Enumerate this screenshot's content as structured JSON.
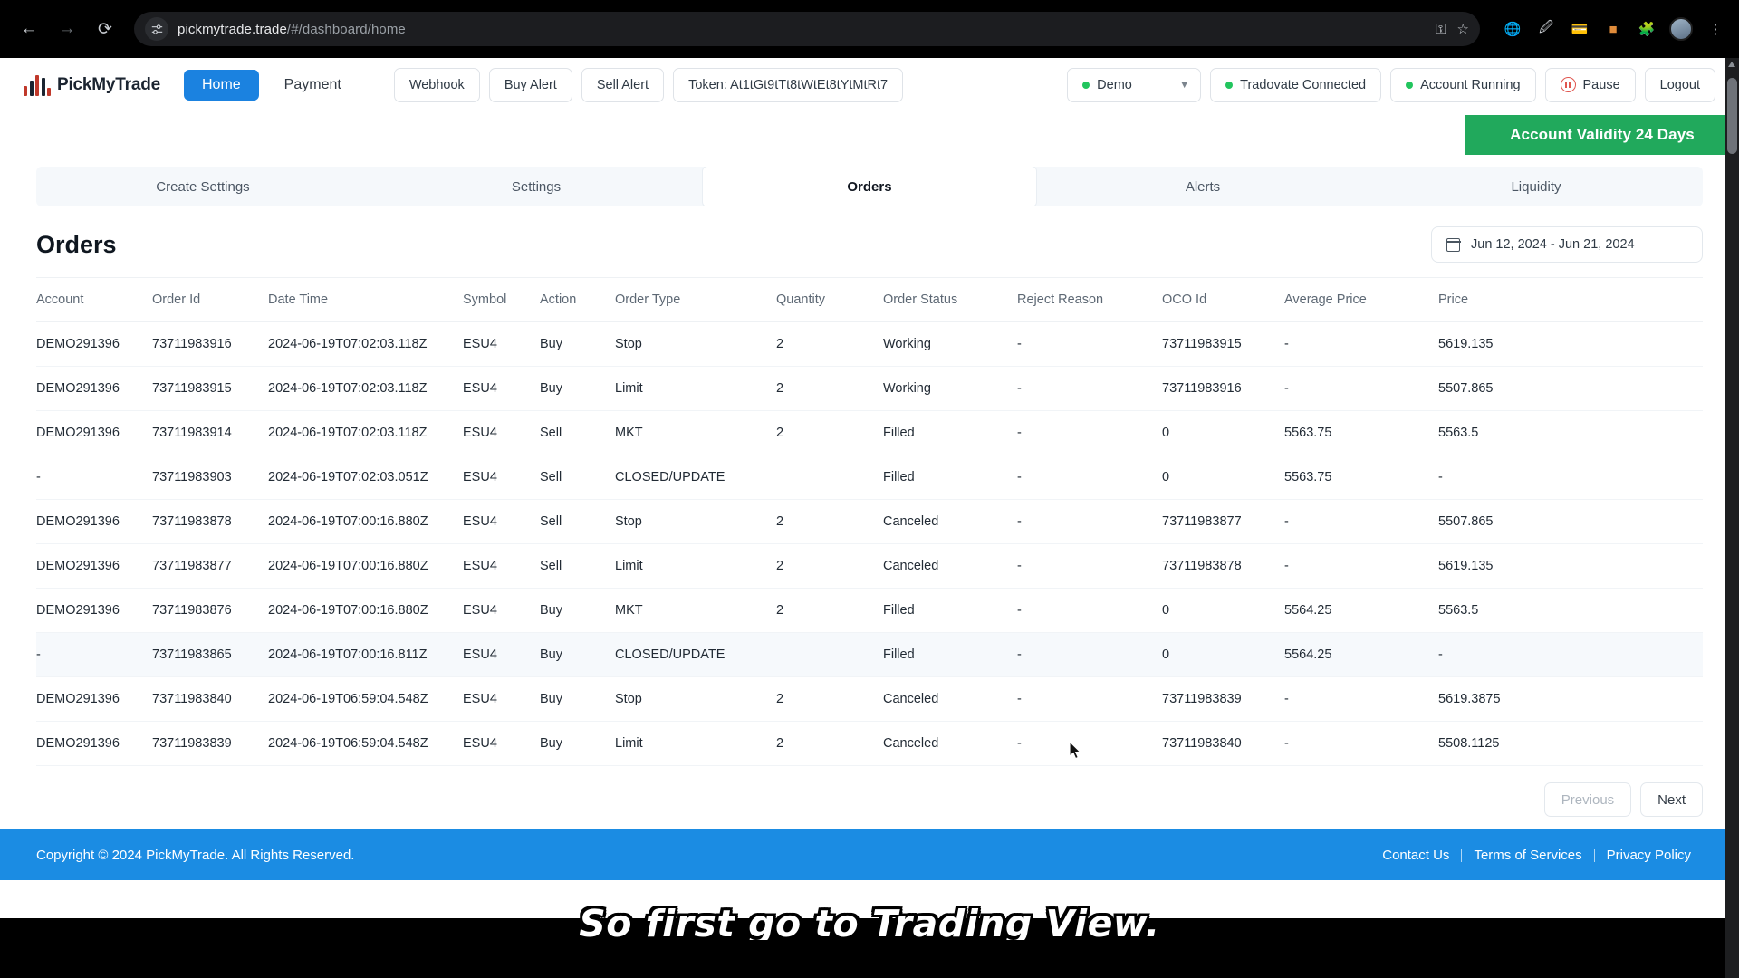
{
  "browser": {
    "url_host": "pickmytrade.trade",
    "url_path": "/#/dashboard/home",
    "back_icon": "back-arrow-icon",
    "forward_icon": "forward-arrow-icon",
    "reload_icon": "reload-icon",
    "site_settings_icon": "site-settings-icon",
    "bookmark_icon": "star-icon",
    "menu_icon": "kebab-menu-icon"
  },
  "header": {
    "brand": "PickMyTrade",
    "nav": {
      "home": "Home",
      "payment": "Payment"
    },
    "buttons": {
      "webhook": "Webhook",
      "buy_alert": "Buy Alert",
      "sell_alert": "Sell Alert",
      "token": "Token: At1tGt9tTt8tWtEt8tYtMtRt7",
      "tradovate": "Tradovate Connected",
      "account_running": "Account Running",
      "pause": "Pause",
      "logout": "Logout"
    },
    "environment_select": {
      "value": "Demo"
    },
    "validity_banner": "Account Validity 24 Days",
    "colors": {
      "accent_blue": "#1b82e0",
      "status_green": "#22c55e",
      "banner_green": "#21a95c",
      "pause_red": "#e0564f",
      "footer_blue": "#1b8ce3"
    }
  },
  "tabs": [
    {
      "label": "Create Settings",
      "active": false
    },
    {
      "label": "Settings",
      "active": false
    },
    {
      "label": "Orders",
      "active": true
    },
    {
      "label": "Alerts",
      "active": false
    },
    {
      "label": "Liquidity",
      "active": false
    }
  ],
  "orders_page": {
    "title": "Orders",
    "date_range": "Jun 12, 2024 - Jun 21, 2024",
    "columns": [
      "Account",
      "Order Id",
      "Date Time",
      "Symbol",
      "Action",
      "Order Type",
      "Quantity",
      "Order Status",
      "Reject Reason",
      "OCO Id",
      "Average Price",
      "Price"
    ],
    "rows": [
      [
        "DEMO291396",
        "73711983916",
        "2024-06-19T07:02:03.118Z",
        "ESU4",
        "Buy",
        "Stop",
        "2",
        "Working",
        "-",
        "73711983915",
        "-",
        "5619.135"
      ],
      [
        "DEMO291396",
        "73711983915",
        "2024-06-19T07:02:03.118Z",
        "ESU4",
        "Buy",
        "Limit",
        "2",
        "Working",
        "-",
        "73711983916",
        "-",
        "5507.865"
      ],
      [
        "DEMO291396",
        "73711983914",
        "2024-06-19T07:02:03.118Z",
        "ESU4",
        "Sell",
        "MKT",
        "2",
        "Filled",
        "-",
        "0",
        "5563.75",
        "5563.5"
      ],
      [
        "-",
        "73711983903",
        "2024-06-19T07:02:03.051Z",
        "ESU4",
        "Sell",
        "CLOSED/UPDATE",
        "",
        "Filled",
        "-",
        "0",
        "5563.75",
        "-"
      ],
      [
        "DEMO291396",
        "73711983878",
        "2024-06-19T07:00:16.880Z",
        "ESU4",
        "Sell",
        "Stop",
        "2",
        "Canceled",
        "-",
        "73711983877",
        "-",
        "5507.865"
      ],
      [
        "DEMO291396",
        "73711983877",
        "2024-06-19T07:00:16.880Z",
        "ESU4",
        "Sell",
        "Limit",
        "2",
        "Canceled",
        "-",
        "73711983878",
        "-",
        "5619.135"
      ],
      [
        "DEMO291396",
        "73711983876",
        "2024-06-19T07:00:16.880Z",
        "ESU4",
        "Buy",
        "MKT",
        "2",
        "Filled",
        "-",
        "0",
        "5564.25",
        "5563.5"
      ],
      [
        "-",
        "73711983865",
        "2024-06-19T07:00:16.811Z",
        "ESU4",
        "Buy",
        "CLOSED/UPDATE",
        "",
        "Filled",
        "-",
        "0",
        "5564.25",
        "-"
      ],
      [
        "DEMO291396",
        "73711983840",
        "2024-06-19T06:59:04.548Z",
        "ESU4",
        "Buy",
        "Stop",
        "2",
        "Canceled",
        "-",
        "73711983839",
        "-",
        "5619.3875"
      ],
      [
        "DEMO291396",
        "73711983839",
        "2024-06-19T06:59:04.548Z",
        "ESU4",
        "Buy",
        "Limit",
        "2",
        "Canceled",
        "-",
        "73711983840",
        "-",
        "5508.1125"
      ]
    ],
    "hovered_row_index": 7,
    "pagination": {
      "previous": "Previous",
      "next": "Next"
    }
  },
  "footer": {
    "copyright": "Copyright © 2024 PickMyTrade. All Rights Reserved.",
    "links": [
      "Contact Us",
      "Terms of Services",
      "Privacy Policy"
    ]
  },
  "caption": "So first go to Trading View."
}
